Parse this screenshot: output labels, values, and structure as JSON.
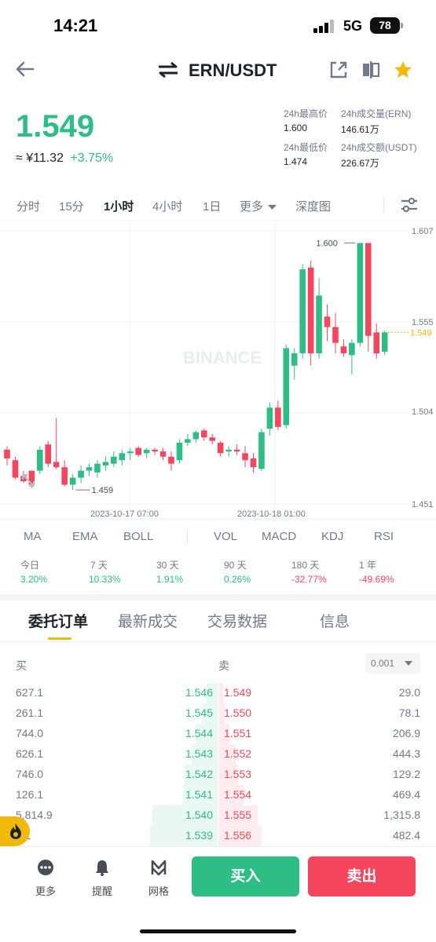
{
  "status": {
    "time": "14:21",
    "network": "5G",
    "battery": "78"
  },
  "header": {
    "pair": "ERN/USDT"
  },
  "price": {
    "last": "1.549",
    "cny": "≈ ¥11.32",
    "change": "+3.75%"
  },
  "stats": [
    {
      "label": "24h最高价",
      "value": "1.600"
    },
    {
      "label": "24h成交量(ERN)",
      "value": "146.61万"
    },
    {
      "label": "24h最低价",
      "value": "1.474"
    },
    {
      "label": "24h成交额(USDT)",
      "value": "226.67万"
    }
  ],
  "timeframes": [
    "分时",
    "15分",
    "1小时",
    "4小时",
    "1日",
    "更多",
    "深度图"
  ],
  "active_timeframe": "1小时",
  "chart_data": {
    "type": "candlestick",
    "price_axis": [
      "1.607",
      "1.555",
      "1.504",
      "1.451"
    ],
    "ylim": [
      1.451,
      1.607
    ],
    "current_price": "1.549",
    "annotations": {
      "high": "1.600",
      "low": "1.459"
    },
    "time_labels": [
      "2023-10-17 07:00",
      "2023-10-18 01:00"
    ],
    "watermark": "BINANCE",
    "candles": [
      [
        1.482,
        1.484,
        1.477,
        1.473
      ],
      [
        1.476,
        1.478,
        1.466,
        1.465
      ],
      [
        1.467,
        1.47,
        1.464,
        1.463
      ],
      [
        1.47,
        1.47,
        1.462,
        1.46
      ],
      [
        1.47,
        1.484,
        1.482,
        1.468
      ],
      [
        1.485,
        1.487,
        1.474,
        1.472
      ],
      [
        1.475,
        1.5,
        1.472,
        1.471
      ],
      [
        1.472,
        1.476,
        1.462,
        1.461
      ],
      [
        1.462,
        1.468,
        1.466,
        1.459
      ],
      [
        1.466,
        1.473,
        1.47,
        1.463
      ],
      [
        1.47,
        1.474,
        1.472,
        1.467
      ],
      [
        1.469,
        1.476,
        1.474,
        1.466
      ],
      [
        1.473,
        1.478,
        1.475,
        1.47
      ],
      [
        1.474,
        1.481,
        1.478,
        1.472
      ],
      [
        1.476,
        1.482,
        1.48,
        1.473
      ],
      [
        1.48,
        1.483,
        1.481,
        1.476
      ],
      [
        1.483,
        1.484,
        1.479,
        1.478
      ],
      [
        1.48,
        1.483,
        1.482,
        1.477
      ],
      [
        1.482,
        1.483,
        1.481,
        1.479
      ],
      [
        1.481,
        1.483,
        1.478,
        1.476
      ],
      [
        1.478,
        1.481,
        1.474,
        1.47
      ],
      [
        1.476,
        1.488,
        1.486,
        1.474
      ],
      [
        1.486,
        1.491,
        1.488,
        1.484
      ],
      [
        1.488,
        1.493,
        1.492,
        1.486
      ],
      [
        1.493,
        1.494,
        1.489,
        1.487
      ],
      [
        1.489,
        1.491,
        1.487,
        1.485
      ],
      [
        1.486,
        1.487,
        1.48,
        1.478
      ],
      [
        1.481,
        1.484,
        1.482,
        1.478
      ],
      [
        1.482,
        1.485,
        1.481,
        1.479
      ],
      [
        1.48,
        1.484,
        1.476,
        1.472
      ],
      [
        1.477,
        1.48,
        1.472,
        1.469
      ],
      [
        1.471,
        1.494,
        1.492,
        1.47
      ],
      [
        1.494,
        1.509,
        1.506,
        1.49
      ],
      [
        1.506,
        1.51,
        1.495,
        1.493
      ],
      [
        1.496,
        1.542,
        1.54,
        1.494
      ],
      [
        1.53,
        1.54,
        1.537,
        1.522
      ],
      [
        1.537,
        1.588,
        1.585,
        1.534
      ],
      [
        1.586,
        1.59,
        1.537,
        1.53
      ],
      [
        1.537,
        1.58,
        1.57,
        1.534
      ],
      [
        1.558,
        1.565,
        1.552,
        1.544
      ],
      [
        1.552,
        1.56,
        1.543,
        1.537
      ],
      [
        1.541,
        1.545,
        1.537,
        1.535
      ],
      [
        1.536,
        1.545,
        1.543,
        1.525
      ],
      [
        1.543,
        1.6,
        1.6,
        1.541
      ],
      [
        1.6,
        1.6,
        1.547,
        1.538
      ],
      [
        1.549,
        1.554,
        1.537,
        1.534
      ],
      [
        1.538,
        1.55,
        1.549,
        1.536
      ]
    ]
  },
  "indicators": [
    "MA",
    "EMA",
    "BOLL",
    "VOL",
    "MACD",
    "KDJ",
    "RSI"
  ],
  "performance": [
    {
      "label": "今日",
      "value": "3.20%",
      "dir": "up"
    },
    {
      "label": "7 天",
      "value": "10.33%",
      "dir": "up"
    },
    {
      "label": "30 天",
      "value": "1.91%",
      "dir": "up"
    },
    {
      "label": "90 天",
      "value": "0.26%",
      "dir": "up"
    },
    {
      "label": "180 天",
      "value": "-32.77%",
      "dir": "down"
    },
    {
      "label": "1 年",
      "value": "-49.69%",
      "dir": "down"
    }
  ],
  "order_tabs": [
    "委托订单",
    "最新成交",
    "交易数据",
    "信息"
  ],
  "orderbook": {
    "buy_label": "买",
    "sell_label": "卖",
    "precision": "0.001",
    "rows": [
      {
        "bid_qty": "627.1",
        "bid_price": "1.546",
        "ask_price": "1.549",
        "ask_qty": "29.0",
        "bid_depth": 0.05,
        "ask_depth": 0.02
      },
      {
        "bid_qty": "261.1",
        "bid_price": "1.545",
        "ask_price": "1.550",
        "ask_qty": "78.1",
        "bid_depth": 0.07,
        "ask_depth": 0.03
      },
      {
        "bid_qty": "744.0",
        "bid_price": "1.544",
        "ask_price": "1.551",
        "ask_qty": "206.9",
        "bid_depth": 0.1,
        "ask_depth": 0.05
      },
      {
        "bid_qty": "626.1",
        "bid_price": "1.543",
        "ask_price": "1.552",
        "ask_qty": "444.3",
        "bid_depth": 0.12,
        "ask_depth": 0.08
      },
      {
        "bid_qty": "746.0",
        "bid_price": "1.542",
        "ask_price": "1.553",
        "ask_qty": "129.2",
        "bid_depth": 0.15,
        "ask_depth": 0.09
      },
      {
        "bid_qty": "126.1",
        "bid_price": "1.541",
        "ask_price": "1.554",
        "ask_qty": "469.4",
        "bid_depth": 0.16,
        "ask_depth": 0.12
      },
      {
        "bid_qty": "5,814.9",
        "bid_price": "1.540",
        "ask_price": "1.555",
        "ask_qty": "1,315.8",
        "bid_depth": 0.3,
        "ask_depth": 0.18
      },
      {
        "bid_qty": "6.1",
        "bid_price": "1.539",
        "ask_price": "1.556",
        "ask_qty": "482.4",
        "bid_depth": 0.31,
        "ask_depth": 0.2
      }
    ]
  },
  "bottom_nav": [
    {
      "label": "更多",
      "icon": "more-icon"
    },
    {
      "label": "提醒",
      "icon": "bell-icon"
    },
    {
      "label": "网格",
      "icon": "grid-icon"
    }
  ],
  "actions": {
    "buy": "买入",
    "sell": "卖出"
  },
  "colors": {
    "up": "#2ebd85",
    "down": "#f6465d",
    "accent": "#f0b90b"
  }
}
